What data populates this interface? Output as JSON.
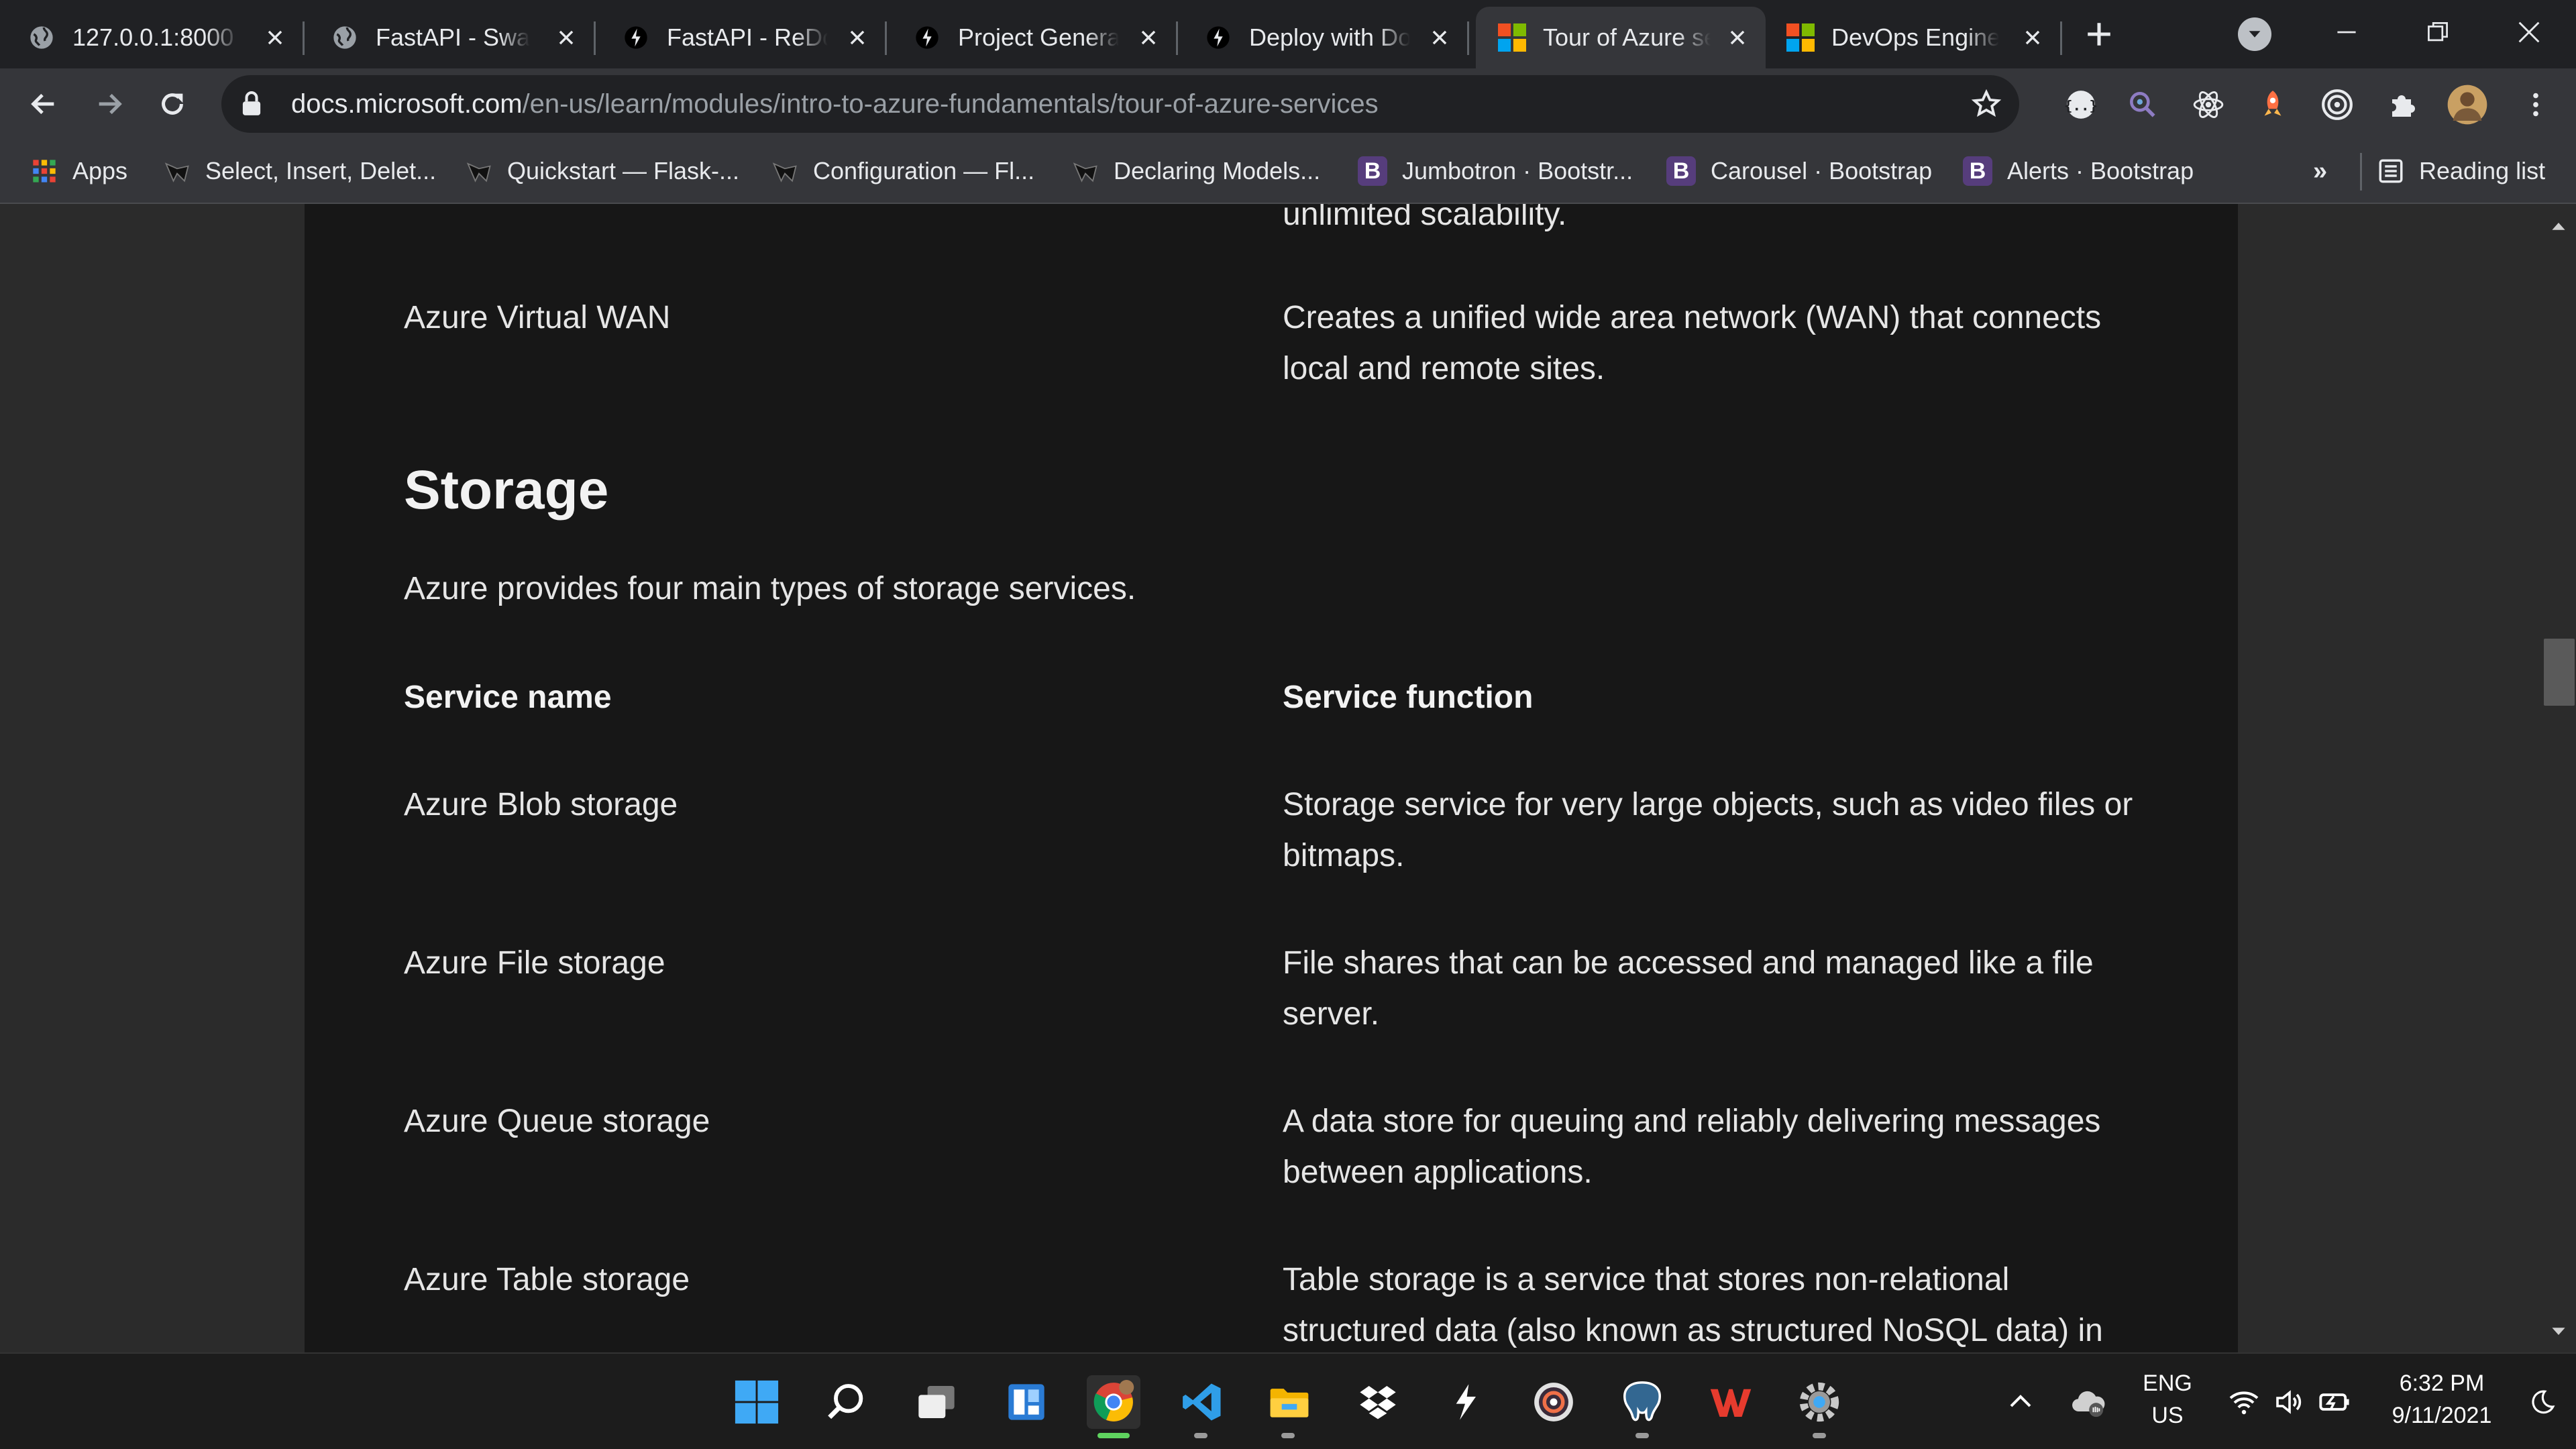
{
  "browser": {
    "tabs": [
      {
        "title": "127.0.0.1:8000",
        "icon": "globe-icon"
      },
      {
        "title": "FastAPI - Swagger UI",
        "icon": "globe-icon"
      },
      {
        "title": "FastAPI - ReDoc",
        "icon": "fastapi-icon"
      },
      {
        "title": "Project Generation",
        "icon": "fastapi-icon"
      },
      {
        "title": "Deploy with Docker",
        "icon": "fastapi-icon"
      },
      {
        "title": "Tour of Azure services",
        "icon": "microsoft-icon",
        "active": true
      },
      {
        "title": "DevOps Engineer",
        "icon": "microsoft-icon"
      }
    ],
    "url_host": "docs.microsoft.com",
    "url_path": "/en-us/learn/modules/intro-to-azure-fundamentals/tour-of-azure-services",
    "bookmarks": [
      {
        "label": "Apps",
        "icon": "apps-grid-icon"
      },
      {
        "label": "Select, Insert, Delet...",
        "icon": "sqlalchemy-icon"
      },
      {
        "label": "Quickstart — Flask-...",
        "icon": "sqlalchemy-icon"
      },
      {
        "label": "Configuration — Fl...",
        "icon": "sqlalchemy-icon"
      },
      {
        "label": "Declaring Models...",
        "icon": "sqlalchemy-icon"
      },
      {
        "label": "Jumbotron · Bootstr...",
        "icon": "bootstrap-icon"
      },
      {
        "label": "Carousel · Bootstrap",
        "icon": "bootstrap-icon"
      },
      {
        "label": "Alerts · Bootstrap",
        "icon": "bootstrap-icon"
      }
    ],
    "bookmark_overflow": "»",
    "reading_list": "Reading list",
    "bootstrap_letter": "B"
  },
  "article": {
    "partial_top_text": "unlimited scalability.",
    "virtual_wan": {
      "name": "Azure Virtual WAN",
      "desc_line1": "Creates a unified wide area network (WAN) that connects",
      "desc_line2": "local and remote sites."
    },
    "storage_heading": "Storage",
    "storage_intro": "Azure provides four main types of storage services.",
    "table_headers": {
      "name": "Service name",
      "function": "Service function"
    },
    "rows": [
      {
        "name": "Azure Blob storage",
        "line1": "Storage service for very large objects, such as video files or",
        "line2": "bitmaps."
      },
      {
        "name": "Azure File storage",
        "line1": "File shares that can be accessed and managed like a file",
        "line2": "server."
      },
      {
        "name": "Azure Queue storage",
        "line1": "A data store for queuing and reliably delivering messages",
        "line2": "between applications."
      },
      {
        "name": "Azure Table storage",
        "line1": "Table storage is a service that stores non-relational",
        "line2": "structured data (also known as structured NoSQL data) in"
      }
    ]
  },
  "taskbar": {
    "apps": [
      "windows-start-icon",
      "search-icon",
      "task-view-icon",
      "widgets-icon",
      "chrome-icon",
      "vscode-icon",
      "file-explorer-icon",
      "dropbox-icon",
      "postman-icon",
      "obs-icon",
      "pgadmin-icon",
      "wps-icon",
      "settings-icon"
    ],
    "lang_line1": "ENG",
    "lang_line2": "US",
    "time": "6:32 PM",
    "date": "9/11/2021"
  },
  "colors": {
    "page_bg": "#171717",
    "tab_active": "#35363a",
    "tabstrip": "#202124",
    "taskbar": "#1c1c1c"
  }
}
